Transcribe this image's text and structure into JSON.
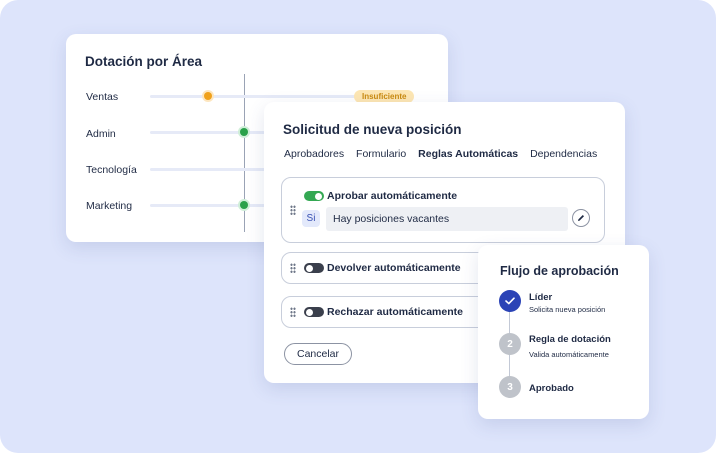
{
  "dotacion": {
    "title": "Dotación por Área",
    "badge": "Insuficiente",
    "rows": [
      {
        "label": "Ventas",
        "status": "orange"
      },
      {
        "label": "Admin",
        "status": "green"
      },
      {
        "label": "Tecnología",
        "status": "none"
      },
      {
        "label": "Marketing",
        "status": "green"
      }
    ]
  },
  "solicitud": {
    "title": "Solicitud de nueva posición",
    "tabs": [
      "Aprobadores",
      "Formulario",
      "Reglas Automáticas",
      "Dependencias"
    ],
    "active_tab": "Reglas Automáticas",
    "rules": [
      {
        "label": "Aprobar automáticamente",
        "enabled": true,
        "condition_tag": "Si",
        "condition_value": "Hay posiciones vacantes"
      },
      {
        "label": "Devolver automáticamente",
        "enabled": false
      },
      {
        "label": "Rechazar automáticamente",
        "enabled": false
      }
    ],
    "cancel_label": "Cancelar"
  },
  "flujo": {
    "title": "Flujo de aprobación",
    "steps": [
      {
        "marker": "",
        "title": "Líder",
        "subtitle": "Solicita nueva posición",
        "state": "done"
      },
      {
        "marker": "2",
        "title": "Regla de dotación",
        "subtitle": "Valida automáticamente",
        "state": "pending"
      },
      {
        "marker": "3",
        "title": "Aprobado",
        "subtitle": "",
        "state": "pending"
      }
    ]
  },
  "colors": {
    "background": "#dde4fb",
    "accent": "#2b43b6",
    "toggle_on": "#34a853",
    "warning": "#f0a11b",
    "success": "#2aa14a"
  }
}
